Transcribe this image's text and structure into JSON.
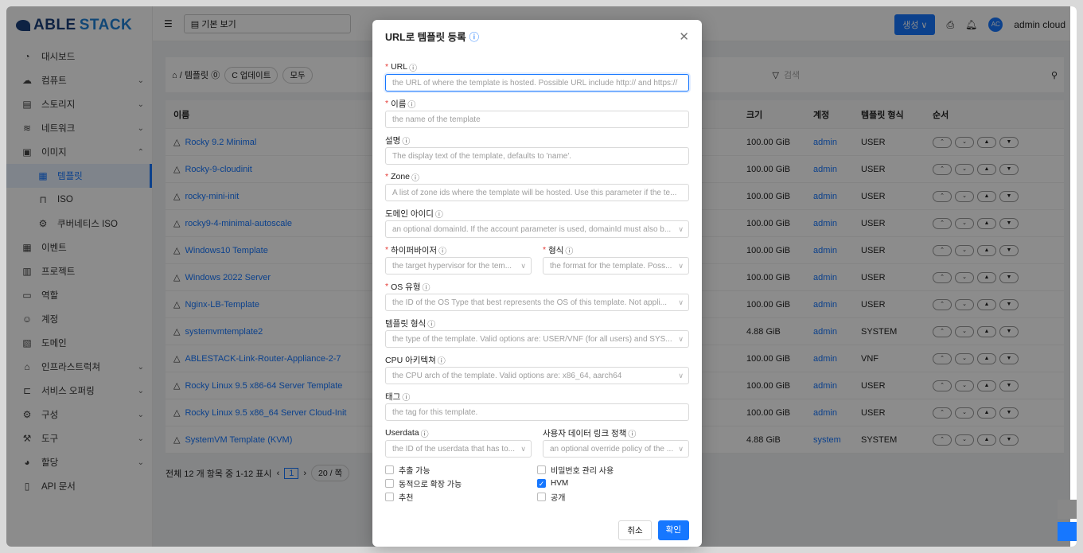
{
  "brand": {
    "part1": "ABLE",
    "part2": "STACK"
  },
  "sidebar": {
    "items": [
      {
        "label": "대시보드",
        "icon": "dashboard-icon",
        "glyph": "◔"
      },
      {
        "label": "컴퓨트",
        "icon": "cloud-icon",
        "glyph": "☁",
        "chev": "⌄"
      },
      {
        "label": "스토리지",
        "icon": "storage-icon",
        "glyph": "▤",
        "chev": "⌄"
      },
      {
        "label": "네트워크",
        "icon": "wifi-icon",
        "glyph": "≋",
        "chev": "⌄"
      },
      {
        "label": "이미지",
        "icon": "picture-icon",
        "glyph": "▣",
        "chev": "⌃"
      },
      {
        "label": "템플릿",
        "icon": "template-icon",
        "glyph": "▦",
        "sub": true,
        "active": true
      },
      {
        "label": "ISO",
        "icon": "iso-icon",
        "glyph": "⊓",
        "sub": true
      },
      {
        "label": "쿠버네티스 ISO",
        "icon": "kubernetes-icon",
        "glyph": "⚙",
        "sub": true
      },
      {
        "label": "이벤트",
        "icon": "calendar-icon",
        "glyph": "▦"
      },
      {
        "label": "프로젝트",
        "icon": "project-icon",
        "glyph": "▥"
      },
      {
        "label": "역할",
        "icon": "role-icon",
        "glyph": "▭"
      },
      {
        "label": "계정",
        "icon": "account-icon",
        "glyph": "☺"
      },
      {
        "label": "도메인",
        "icon": "domain-icon",
        "glyph": "▧"
      },
      {
        "label": "인프라스트럭쳐",
        "icon": "bank-icon",
        "glyph": "⌂",
        "chev": "⌄"
      },
      {
        "label": "서비스 오퍼링",
        "icon": "shopping-icon",
        "glyph": "⊏",
        "chev": "⌄"
      },
      {
        "label": "구성",
        "icon": "gear-icon",
        "glyph": "⚙",
        "chev": "⌄"
      },
      {
        "label": "도구",
        "icon": "tool-icon",
        "glyph": "⚒",
        "chev": "⌄"
      },
      {
        "label": "할당",
        "icon": "pie-icon",
        "glyph": "◕",
        "chev": "⌄"
      },
      {
        "label": "API 문서",
        "icon": "book-icon",
        "glyph": "▯"
      }
    ]
  },
  "topbar": {
    "view": "기본 보기",
    "create": "생성 ∨",
    "user": "admin cloud",
    "avatar": "AC"
  },
  "toolbar": {
    "crumb": "⌂ / 템플릿 ⓪",
    "update": "C 업데이트",
    "filter": "모두",
    "search": "검색"
  },
  "table": {
    "headers": {
      "name": "이름",
      "size": "크기",
      "account": "계정",
      "format": "템플릿 형식",
      "order": "순서"
    },
    "rows": [
      {
        "name": "Rocky 9.2 Minimal",
        "size": "100.00 GiB",
        "account": "admin",
        "format": "USER"
      },
      {
        "name": "Rocky-9-cloudinit",
        "size": "100.00 GiB",
        "account": "admin",
        "format": "USER"
      },
      {
        "name": "rocky-mini-init",
        "size": "100.00 GiB",
        "account": "admin",
        "format": "USER"
      },
      {
        "name": "rocky9-4-minimal-autoscale",
        "size": "100.00 GiB",
        "account": "admin",
        "format": "USER"
      },
      {
        "name": "Windows10 Template",
        "size": "100.00 GiB",
        "account": "admin",
        "format": "USER"
      },
      {
        "name": "Windows 2022 Server",
        "size": "100.00 GiB",
        "account": "admin",
        "format": "USER"
      },
      {
        "name": "Nginx-LB-Template",
        "size": "100.00 GiB",
        "account": "admin",
        "format": "USER"
      },
      {
        "name": "systemvmtemplate2",
        "size": "4.88 GiB",
        "account": "admin",
        "format": "SYSTEM"
      },
      {
        "name": "ABLESTACK-Link-Router-Appliance-2-7",
        "size": "100.00 GiB",
        "account": "admin",
        "format": "VNF"
      },
      {
        "name": "Rocky Linux 9.5 x86-64 Server Template",
        "size": "100.00 GiB",
        "account": "admin",
        "format": "USER"
      },
      {
        "name": "Rocky Linux 9.5 x86_64 Server Cloud-Init",
        "size": "100.00 GiB",
        "account": "admin",
        "format": "USER"
      },
      {
        "name": "SystemVM Template (KVM)",
        "size": "4.88 GiB",
        "account": "system",
        "format": "SYSTEM"
      }
    ]
  },
  "pager": {
    "summary": "전체 12 개 항목 중 1-12 표시",
    "page": "1",
    "per_page": "20 / 쪽"
  },
  "modal": {
    "title": "URL로 템플릿 등록",
    "url": {
      "label": "URL",
      "placeholder": "the URL of where the template is hosted. Possible URL include http:// and https://"
    },
    "name": {
      "label": "이름",
      "placeholder": "the name of the template"
    },
    "desc": {
      "label": "설명",
      "placeholder": "The display text of the template, defaults to 'name'."
    },
    "zone": {
      "label": "Zone",
      "placeholder": "A list of zone ids where the template will be hosted. Use this parameter if the te..."
    },
    "domain": {
      "label": "도메인 아이디",
      "placeholder": "an optional domainId. If the account parameter is used, domainId must also b..."
    },
    "hypervisor": {
      "label": "하이퍼바이저",
      "placeholder": "the target hypervisor for the tem..."
    },
    "format": {
      "label": "형식",
      "placeholder": "the format for the template. Poss..."
    },
    "ostype": {
      "label": "OS 유형",
      "placeholder": "the ID of the OS Type that best represents the OS of this template. Not appli..."
    },
    "tpltype": {
      "label": "템플릿 형식",
      "placeholder": "the type of the template. Valid options are: USER/VNF (for all users) and SYS..."
    },
    "cpu": {
      "label": "CPU 아키텍쳐",
      "placeholder": "the CPU arch of the template. Valid options are: x86_64, aarch64"
    },
    "tag": {
      "label": "태그",
      "placeholder": "the tag for this template."
    },
    "userdata": {
      "label": "Userdata",
      "placeholder": "the ID of the userdata that has to..."
    },
    "udpolicy": {
      "label": "사용자 데이터 링크 정책",
      "placeholder": "an optional override policy of the ..."
    },
    "checks": [
      {
        "label": "추출 가능",
        "checked": false
      },
      {
        "label": "비밀번호 관리 사용",
        "checked": false
      },
      {
        "label": "동적으로 확장 가능",
        "checked": false
      },
      {
        "label": "HVM",
        "checked": true
      },
      {
        "label": "추천",
        "checked": false
      },
      {
        "label": "공개",
        "checked": false
      }
    ],
    "cancel": "취소",
    "ok": "확인"
  }
}
